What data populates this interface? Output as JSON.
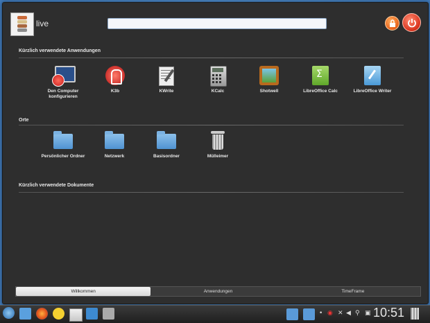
{
  "user": {
    "name": "live"
  },
  "search": {
    "placeholder": ""
  },
  "sections": {
    "recent_apps": "Kürzlich verwendete Anwendungen",
    "places": "Orte",
    "recent_docs": "Kürzlich verwendete Dokumente"
  },
  "recent_apps": [
    {
      "label": "Den Computer konfigurieren",
      "icon": "monitor-settings-icon"
    },
    {
      "label": "K3b",
      "icon": "k3b-icon"
    },
    {
      "label": "KWrite",
      "icon": "kwrite-icon"
    },
    {
      "label": "KCalc",
      "icon": "kcalc-icon"
    },
    {
      "label": "Shotwell",
      "icon": "shotwell-icon"
    },
    {
      "label": "LibreOffice Calc",
      "icon": "libreoffice-calc-icon"
    },
    {
      "label": "LibreOffice Writer",
      "icon": "libreoffice-writer-icon"
    }
  ],
  "places": [
    {
      "label": "Persönlicher Ordner",
      "icon": "home-folder-icon"
    },
    {
      "label": "Netzwerk",
      "icon": "network-folder-icon"
    },
    {
      "label": "Basisordner",
      "icon": "folder-icon"
    },
    {
      "label": "Mülleimer",
      "icon": "trash-icon"
    }
  ],
  "tabs": [
    {
      "label": "Willkommen",
      "active": true
    },
    {
      "label": "Anwendungen",
      "active": false
    },
    {
      "label": "TimeFrame",
      "active": false
    }
  ],
  "clock": "10:51",
  "colors": {
    "accent": "#e8611a",
    "panel": "#2e2e2e",
    "desktop": "#3f78b6"
  }
}
